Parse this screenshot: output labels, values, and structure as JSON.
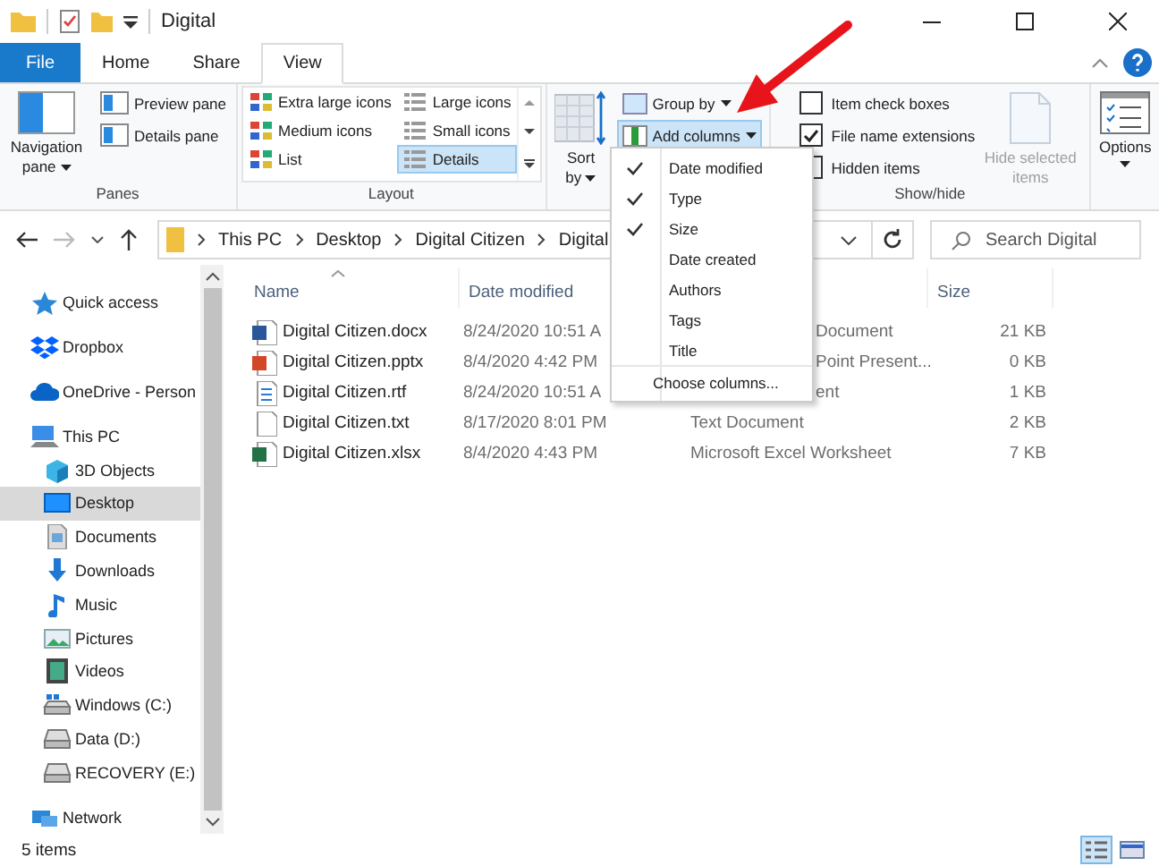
{
  "window": {
    "title": "Digital"
  },
  "tabs": [
    {
      "label": "File",
      "kind": "file",
      "selected": false
    },
    {
      "label": "Home",
      "kind": "tab",
      "selected": false
    },
    {
      "label": "Share",
      "kind": "tab",
      "selected": false
    },
    {
      "label": "View",
      "kind": "tab",
      "selected": true
    }
  ],
  "ribbon": {
    "panes": {
      "label": "Panes",
      "navigation_pane": "Navigation pane",
      "items": [
        "Preview pane",
        "Details pane"
      ]
    },
    "layout": {
      "label": "Layout",
      "items": [
        {
          "label": "Extra large icons",
          "selected": false
        },
        {
          "label": "Large icons",
          "selected": false
        },
        {
          "label": "Medium icons",
          "selected": false
        },
        {
          "label": "Small icons",
          "selected": false
        },
        {
          "label": "List",
          "selected": false
        },
        {
          "label": "Details",
          "selected": true
        }
      ]
    },
    "current_view": {
      "sort_by": "Sort by",
      "group_by": "Group by",
      "add_columns": {
        "label": "Add columns",
        "open": true
      }
    },
    "show_hide": {
      "label": "Show/hide",
      "checkboxes": [
        {
          "label": "Item check boxes",
          "checked": false
        },
        {
          "label": "File name extensions",
          "checked": true
        },
        {
          "label": "Hidden items",
          "checked": false
        }
      ],
      "hide_selected": {
        "label": "Hide selected items",
        "disabled": true
      }
    },
    "options": "Options"
  },
  "address": {
    "breadcrumbs": [
      "This PC",
      "Desktop",
      "Digital Citizen",
      "Digital"
    ]
  },
  "search": {
    "placeholder": "Search Digital"
  },
  "sidebar": {
    "items": [
      {
        "label": "Quick access",
        "kind": "star",
        "selected": false
      },
      {
        "label": "Dropbox",
        "kind": "dropbox",
        "selected": false
      },
      {
        "label": "OneDrive - Person",
        "kind": "cloud",
        "selected": false
      },
      {
        "label": "This PC",
        "kind": "pc",
        "selected": false,
        "children": [
          {
            "label": "3D Objects",
            "kind": "cube",
            "selected": false
          },
          {
            "label": "Desktop",
            "kind": "desktop",
            "selected": true
          },
          {
            "label": "Documents",
            "kind": "documents",
            "selected": false
          },
          {
            "label": "Downloads",
            "kind": "downloads",
            "selected": false
          },
          {
            "label": "Music",
            "kind": "music",
            "selected": false
          },
          {
            "label": "Pictures",
            "kind": "pictures",
            "selected": false
          },
          {
            "label": "Videos",
            "kind": "videos",
            "selected": false
          },
          {
            "label": "Windows (C:)",
            "kind": "system-drive",
            "selected": false
          },
          {
            "label": "Data (D:)",
            "kind": "drive",
            "selected": false
          },
          {
            "label": "RECOVERY (E:)",
            "kind": "drive",
            "selected": false
          }
        ]
      },
      {
        "label": "Network",
        "kind": "network",
        "selected": false
      }
    ]
  },
  "file_list": {
    "columns": [
      {
        "label": "Name",
        "sorted": true
      },
      {
        "label": "Date modified",
        "sorted": false
      },
      {
        "label": "Size",
        "sorted": false
      }
    ],
    "rows": [
      {
        "name": "Digital Citizen.docx",
        "kind": "word",
        "date": "8/24/2020 10:51 A",
        "type": "Document",
        "covered": true,
        "size": "21 KB"
      },
      {
        "name": "Digital Citizen.pptx",
        "kind": "powerpoint",
        "date": "8/4/2020 4:42 PM",
        "type": "Point Present...",
        "covered": true,
        "size": "0 KB"
      },
      {
        "name": "Digital Citizen.rtf",
        "kind": "rtf",
        "date": "8/24/2020 10:51 A",
        "type": "ent",
        "covered": true,
        "size": "1 KB"
      },
      {
        "name": "Digital Citizen.txt",
        "kind": "text",
        "date": "8/17/2020 8:01 PM",
        "type": "Text Document",
        "covered": false,
        "size": "2 KB"
      },
      {
        "name": "Digital Citizen.xlsx",
        "kind": "excel",
        "date": "8/4/2020 4:43 PM",
        "type": "Microsoft Excel Worksheet",
        "covered": false,
        "size": "7 KB"
      }
    ]
  },
  "columns_menu": {
    "items": [
      {
        "label": "Date modified",
        "kind": "column",
        "checked": true
      },
      {
        "label": "Type",
        "kind": "column",
        "checked": true
      },
      {
        "label": "Size",
        "kind": "column",
        "checked": true
      },
      {
        "label": "Date created",
        "kind": "column",
        "checked": false
      },
      {
        "label": "Authors",
        "kind": "column",
        "checked": false
      },
      {
        "label": "Tags",
        "kind": "column",
        "checked": false
      },
      {
        "label": "Title",
        "kind": "column",
        "checked": false
      },
      {
        "label": "Choose columns...",
        "kind": "command",
        "checked": false
      }
    ]
  },
  "status_bar": {
    "item_count": "5 items",
    "view_buttons": [
      {
        "kind": "details",
        "selected": true
      },
      {
        "kind": "large-icons",
        "selected": false
      }
    ]
  }
}
